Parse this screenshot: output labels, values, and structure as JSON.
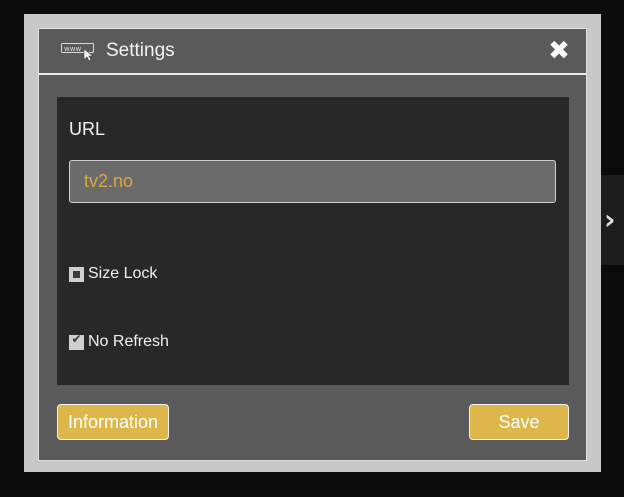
{
  "dialog": {
    "title": "Settings",
    "title_icon": "www-cursor-icon",
    "close_icon": "close-icon",
    "close_glyph": "✖"
  },
  "url": {
    "label": "URL",
    "value": "tv2.no"
  },
  "options": {
    "size_lock": {
      "label": "Size Lock",
      "checked": false
    },
    "no_refresh": {
      "label": "No Refresh",
      "checked": true
    }
  },
  "buttons": {
    "information": "Information",
    "save": "Save"
  },
  "colors": {
    "accent": "#deb74b",
    "input_text": "#d8a93a",
    "panel": "#282828",
    "dialog": "#5a5a5a"
  }
}
